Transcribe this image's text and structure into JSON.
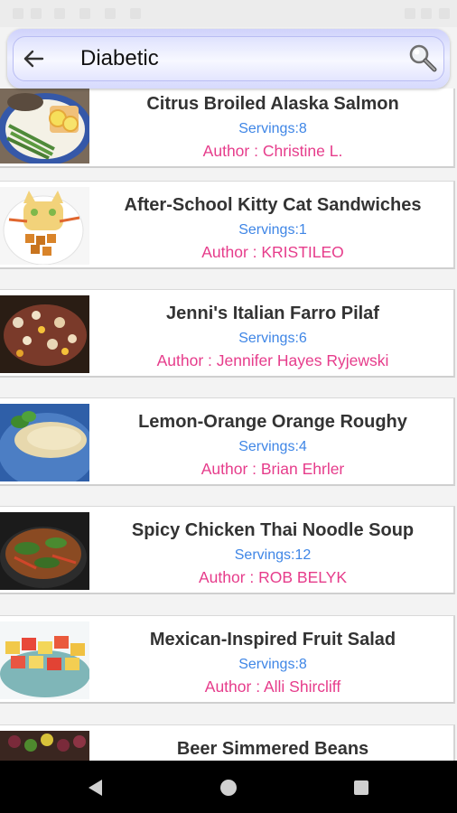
{
  "search": {
    "query": "Diabetic",
    "back_icon": "arrow-left-icon",
    "search_icon": "magnifier-icon"
  },
  "recipes": [
    {
      "title": "Citrus Broiled Alaska Salmon",
      "servings": "Servings:8",
      "author": "Author : Christine L."
    },
    {
      "title": "After-School Kitty Cat Sandwiches",
      "servings": "Servings:1",
      "author": "Author : KRISTILEO"
    },
    {
      "title": "Jenni's Italian Farro Pilaf",
      "servings": "Servings:6",
      "author": "Author : Jennifer Hayes Ryjewski"
    },
    {
      "title": "Lemon-Orange Orange Roughy",
      "servings": "Servings:4",
      "author": "Author : Brian Ehrler"
    },
    {
      "title": "Spicy Chicken Thai Noodle Soup",
      "servings": "Servings:12",
      "author": "Author : ROB BELYK"
    },
    {
      "title": "Mexican-Inspired Fruit Salad",
      "servings": "Servings:8",
      "author": "Author : Alli Shircliff"
    },
    {
      "title": "Beer Simmered Beans",
      "servings": "",
      "author": ""
    }
  ],
  "colors": {
    "title": "#333333",
    "servings": "#3f86e6",
    "author": "#e63c8b",
    "search_bar": "#d7dafd"
  },
  "nav": {
    "back_icon": "triangle-back-icon",
    "home_icon": "circle-home-icon",
    "recents_icon": "square-recents-icon"
  }
}
